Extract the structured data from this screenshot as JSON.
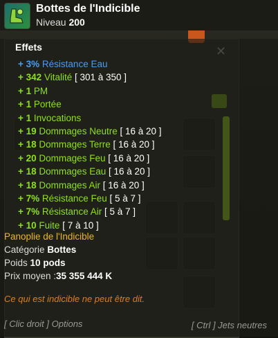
{
  "item": {
    "name": "Bottes de l'Indicible",
    "level_label": "Niveau",
    "level": "200"
  },
  "effects_title": "Effets",
  "effects": [
    {
      "value": "+ 3%",
      "name": "Résistance Eau",
      "range": "",
      "color": "#4b9bf0"
    },
    {
      "value": "+ 342",
      "name": "Vitalité",
      "range": "[ 301 à 350 ]",
      "color": "#8ee01a"
    },
    {
      "value": "+ 1",
      "name": "PM",
      "range": "",
      "color": "#8ee01a"
    },
    {
      "value": "+ 1",
      "name": "Portée",
      "range": "",
      "color": "#8ee01a"
    },
    {
      "value": "+ 1",
      "name": "Invocations",
      "range": "",
      "color": "#8ee01a"
    },
    {
      "value": "+ 19",
      "name": "Dommages Neutre",
      "range": "[ 16 à 20 ]",
      "color": "#8ee01a"
    },
    {
      "value": "+ 18",
      "name": "Dommages Terre",
      "range": "[ 16 à 20 ]",
      "color": "#8ee01a"
    },
    {
      "value": "+ 20",
      "name": "Dommages Feu",
      "range": "[ 16 à 20 ]",
      "color": "#8ee01a"
    },
    {
      "value": "+ 18",
      "name": "Dommages Eau",
      "range": "[ 16 à 20 ]",
      "color": "#8ee01a"
    },
    {
      "value": "+ 18",
      "name": "Dommages Air",
      "range": "[ 16 à 20 ]",
      "color": "#8ee01a"
    },
    {
      "value": "+ 7%",
      "name": "Résistance Feu",
      "range": "[ 5 à 7 ]",
      "color": "#8ee01a"
    },
    {
      "value": "+ 7%",
      "name": "Résistance Air",
      "range": "[ 5 à 7 ]",
      "color": "#8ee01a"
    },
    {
      "value": "+ 10",
      "name": "Fuite",
      "range": "[ 7 à 10 ]",
      "color": "#8ee01a"
    }
  ],
  "set_name": "Panoplie de l'Indicible",
  "category": {
    "label": "Catégorie",
    "value": "Bottes"
  },
  "weight": {
    "label": "Poids",
    "value": "10 pods"
  },
  "price": {
    "label": "Prix moyen :",
    "value": "35 355 444 K"
  },
  "description": "Ce qui est indicible ne peut être dit.",
  "hints": {
    "left": "[ Clic droit ] Options",
    "right": "[ Ctrl ] Jets neutres"
  },
  "icons": {
    "item": "boots-icon",
    "bag": "bag-icon",
    "close": "close-icon",
    "settings": "gear-icon"
  }
}
